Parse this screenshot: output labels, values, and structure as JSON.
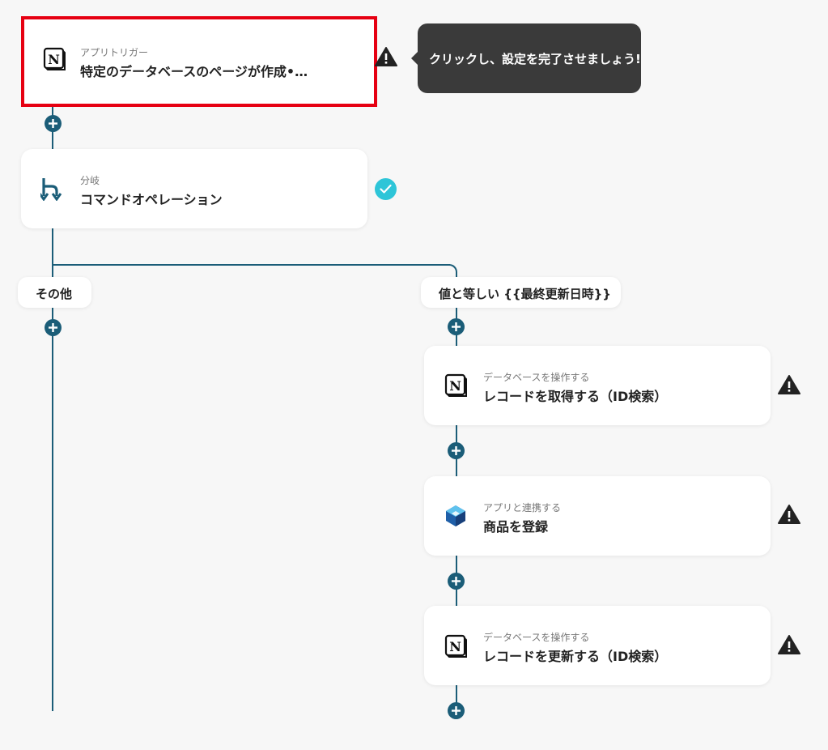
{
  "trigger": {
    "sub": "アプリトリガー",
    "title": "特定のデータベースのページが作成•…",
    "icon": "notion-icon",
    "status": "warning"
  },
  "tooltip": {
    "text": "クリックし、設定を完了させましょう!"
  },
  "branch_step": {
    "sub": "分岐",
    "title": "コマンドオペレーション",
    "icon": "branch-icon",
    "status": "complete"
  },
  "branches": {
    "left_label": "その他",
    "right_label": "値と等しい {{最終更新日時}}"
  },
  "steps": [
    {
      "sub": "データベースを操作する",
      "title": "レコードを取得する（ID検索）",
      "icon": "notion-icon",
      "status": "warning"
    },
    {
      "sub": "アプリと連携する",
      "title": "商品を登録",
      "icon": "cube-app-icon",
      "status": "warning"
    },
    {
      "sub": "データベースを操作する",
      "title": "レコードを更新する（ID検索）",
      "icon": "notion-icon",
      "status": "warning"
    }
  ],
  "colors": {
    "connector": "#1b5d78",
    "selected_border": "#e60012",
    "check": "#2ec5d8",
    "tooltip_bg": "#3a3a3a"
  }
}
